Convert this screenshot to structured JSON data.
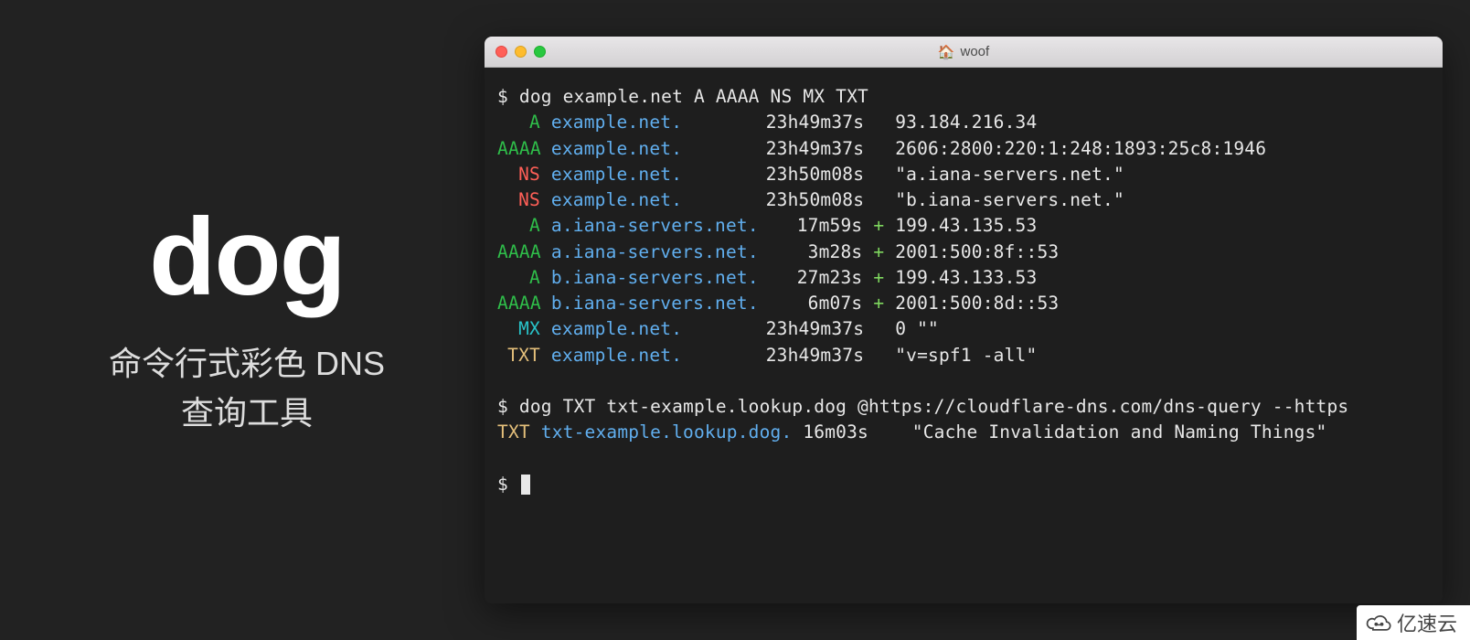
{
  "hero": {
    "title": "dog",
    "subtitle_line1": "命令行式彩色 DNS",
    "subtitle_line2": "查询工具"
  },
  "window": {
    "icon": "🏠",
    "title": "woof"
  },
  "colors": {
    "A": "#2fbf4a",
    "AAAA": "#2fbf4a",
    "NS": "#ff5f57",
    "MX": "#28c3c9",
    "TXT": "#e5c07b",
    "domain": "#61afef",
    "plus": "#7fd75f"
  },
  "session": {
    "prompt": "$",
    "commands": [
      "dog example.net A AAAA NS MX TXT",
      "dog TXT txt-example.lookup.dog @https://cloudflare-dns.com/dns-query --https"
    ],
    "results1": [
      {
        "type": "A",
        "tclass": "c-green",
        "domain": "example.net.",
        "ttl": "23h49m37s",
        "plus": false,
        "value": "93.184.216.34"
      },
      {
        "type": "AAAA",
        "tclass": "c-green",
        "domain": "example.net.",
        "ttl": "23h49m37s",
        "plus": false,
        "value": "2606:2800:220:1:248:1893:25c8:1946"
      },
      {
        "type": "NS",
        "tclass": "c-red",
        "domain": "example.net.",
        "ttl": "23h50m08s",
        "plus": false,
        "value": "\"a.iana-servers.net.\""
      },
      {
        "type": "NS",
        "tclass": "c-red",
        "domain": "example.net.",
        "ttl": "23h50m08s",
        "plus": false,
        "value": "\"b.iana-servers.net.\""
      },
      {
        "type": "A",
        "tclass": "c-green",
        "domain": "a.iana-servers.net.",
        "ttl": "17m59s",
        "plus": true,
        "value": "199.43.135.53"
      },
      {
        "type": "AAAA",
        "tclass": "c-green",
        "domain": "a.iana-servers.net.",
        "ttl": "3m28s",
        "plus": true,
        "value": "2001:500:8f::53"
      },
      {
        "type": "A",
        "tclass": "c-green",
        "domain": "b.iana-servers.net.",
        "ttl": "27m23s",
        "plus": true,
        "value": "199.43.133.53"
      },
      {
        "type": "AAAA",
        "tclass": "c-green",
        "domain": "b.iana-servers.net.",
        "ttl": "6m07s",
        "plus": true,
        "value": "2001:500:8d::53"
      },
      {
        "type": "MX",
        "tclass": "c-cyan",
        "domain": "example.net.",
        "ttl": "23h49m37s",
        "plus": false,
        "value": "0 \"\""
      },
      {
        "type": "TXT",
        "tclass": "c-yellow",
        "domain": "example.net.",
        "ttl": "23h49m37s",
        "plus": false,
        "value": "\"v=spf1 -all\""
      }
    ],
    "results2": [
      {
        "type": "TXT",
        "tclass": "c-yellow",
        "domain": "txt-example.lookup.dog.",
        "ttl": "16m03s",
        "plus": false,
        "value": "\"Cache Invalidation and Naming Things\""
      }
    ]
  },
  "watermark": "亿速云"
}
